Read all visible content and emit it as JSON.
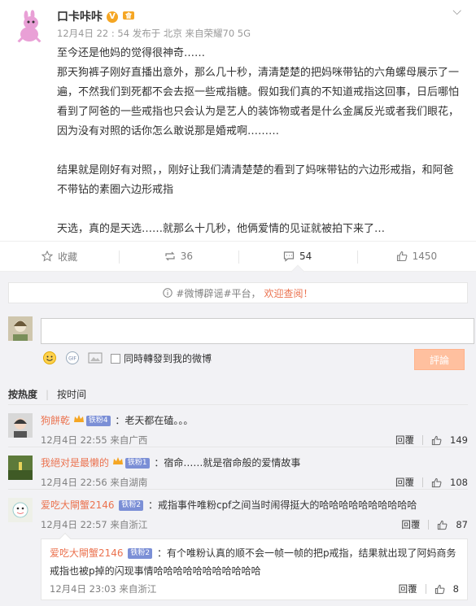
{
  "post": {
    "author": "口卡咔咔",
    "verified_badge": "V",
    "meta": "12月4日 22 : 54 发布于 北京 来自荣耀70 5G",
    "paragraphs": [
      "至今还是他妈的觉得很神奇……",
      "那天狗裤子刚好直播出意外，那么几十秒，清清楚楚的把妈咪带钻的六角螺母展示了一遍，不然我们到死都不会去抠一些戒指糖。假如我们真的不知道戒指这回事，日后哪怕看到了阿爸的一些戒指也只会认为是艺人的装饰物或者是什么金属反光或者我们眼花，因为没有对照的话你怎么敢说那是婚戒啊………",
      "",
      "结果就是刚好有对照，，刚好让我们清清楚楚的看到了妈咪带钻的六边形戒指，和阿爸不带钻的素圈六边形戒指",
      "",
      "天选，真的是天选……就那么十几秒，他俩爱情的见证就被拍下来了…"
    ]
  },
  "actions": {
    "favorite": "收藏",
    "repost": "36",
    "comment": "54",
    "like": "1450"
  },
  "comments_area": {
    "notice_prefix": "#微博辟谣#平台，",
    "notice_link": "欢迎查阅！",
    "sync_label": "同時轉發到我的微博",
    "submit_label": "評論",
    "sort_hot": "按热度",
    "sort_time": "按时间"
  },
  "comments": [
    {
      "user": "狗餅乾",
      "badge": "铁粉4",
      "text": "：老天都在磕。。。",
      "time": "12月4日 22:55 来自广西",
      "reply": "回覆",
      "likes": "149"
    },
    {
      "user": "我絕对是最懒的",
      "badge": "铁粉1",
      "text": "：宿命……就是宿命般的爱情故事",
      "time": "12月4日 22:56 来自湖南",
      "reply": "回覆",
      "likes": "108"
    },
    {
      "user": "爱吃大閘蟹2146",
      "badge": "铁粉2",
      "text": "：戒指事件唯粉cpf之间当时闹得挺大的哈哈哈哈哈哈哈哈哈哈",
      "time": "12月4日 22:57 来自浙江",
      "reply": "回覆",
      "likes": "87"
    }
  ],
  "reply": {
    "user": "爱吃大閘蟹2146",
    "badge": "铁粉2",
    "text": "：有个唯粉认真的顺不会一帧一帧的把p戒指，结果就出现了阿妈商务戒指也被p掉的闪现事情哈哈哈哈哈哈哈哈哈哈哈",
    "time": "12月4日 23:03 来自浙江",
    "reply": "回覆",
    "likes": "8"
  }
}
